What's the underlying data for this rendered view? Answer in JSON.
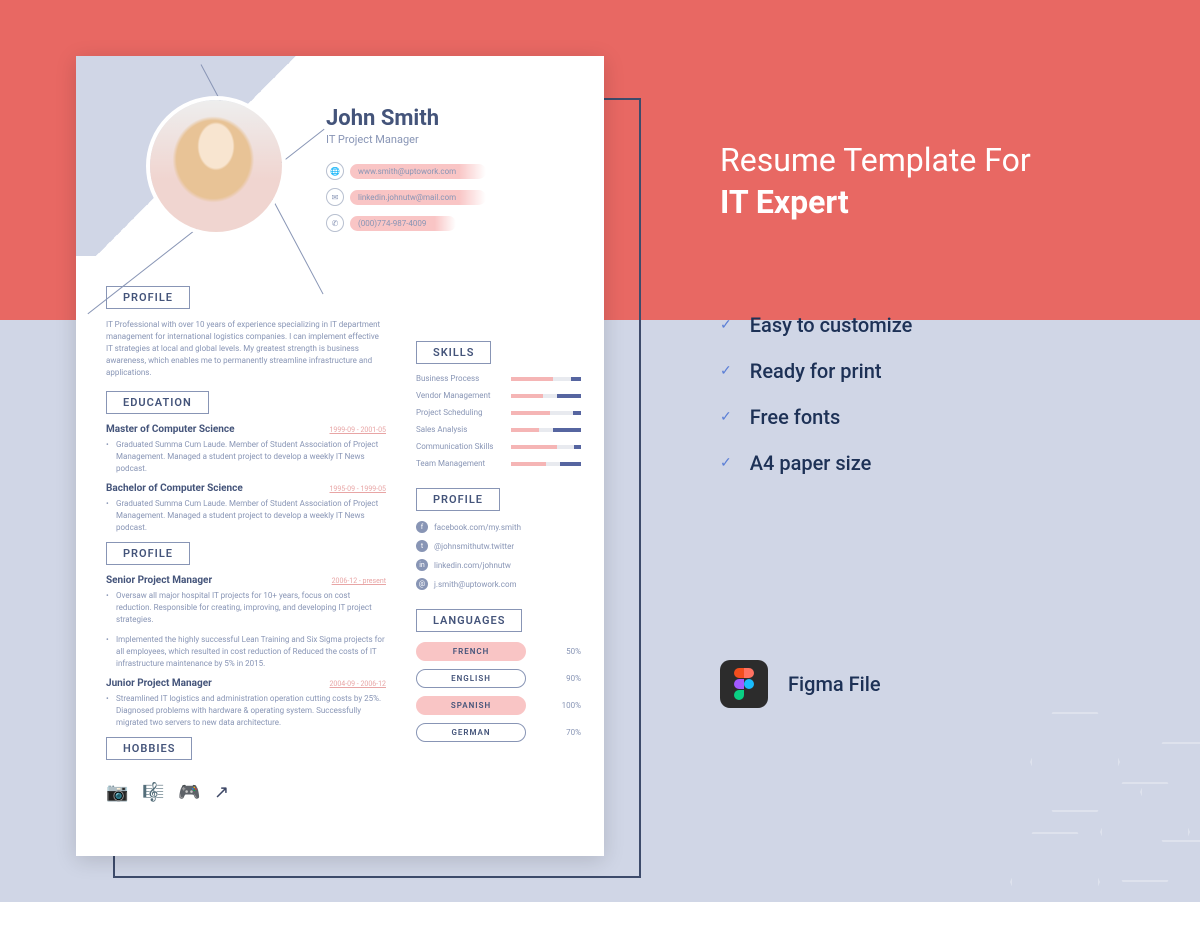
{
  "promo": {
    "title_line1": "Resume Template For",
    "title_line2": "IT Expert"
  },
  "features": [
    "Easy to customize",
    "Ready for print",
    "Free fonts",
    "A4 paper size"
  ],
  "figma_label": "Figma File",
  "resume": {
    "name": "John Smith",
    "role": "IT Project Manager",
    "contacts": [
      {
        "icon": "🌐",
        "text": "www.smith@uptowork.com"
      },
      {
        "icon": "✉",
        "text": "linkedin.johnutw@mail.com"
      },
      {
        "icon": "✆",
        "text": "(000)774-987-4009"
      }
    ],
    "sections": {
      "profile_label": "PROFILE",
      "profile_text": "IT Professional with over 10 years of experience specializing in IT department management for international logistics companies. I can implement effective IT strategies at local and global levels. My greatest strength is business awareness, which enables me to permanently streamline infrastructure and applications.",
      "education_label": "EDUCATION",
      "education": [
        {
          "title": "Master of Computer Science",
          "dates": "1999-09 - 2001-05",
          "desc": "Graduated Summa Cum Laude. Member of Student Association of Project Management. Managed a student project to develop a weekly IT News podcast."
        },
        {
          "title": "Bachelor of Computer Science",
          "dates": "1995-09 - 1999-05",
          "desc": "Graduated Summa Cum Laude. Member of Student Association of Project Management. Managed a student project to develop a weekly IT News podcast."
        }
      ],
      "experience_label": "PROFILE",
      "experience": [
        {
          "title": "Senior Project Manager",
          "dates": "2006-12 - present",
          "bullets": [
            "Oversaw all major hospital IT projects for 10+ years, focus on cost reduction. Responsible for creating, improving, and developing IT project strategies.",
            "Implemented the highly successful Lean Training and Six Sigma projects for all employees, which resulted in cost reduction of Reduced the costs of IT infrastructure maintenance by 5% in 2015."
          ]
        },
        {
          "title": "Junior Project Manager",
          "dates": "2004-09 - 2006-12",
          "bullets": [
            "Streamlined IT logistics and administration operation cutting costs by 25%. Diagnosed problems with hardware & operating system. Successfully migrated two servers to new data architecture."
          ]
        }
      ],
      "hobbies_label": "HOBBIES",
      "skills_label": "SKILLS",
      "skills": [
        {
          "name": "Business Process",
          "pink": 60,
          "blue": 15
        },
        {
          "name": "Vendor Management",
          "pink": 45,
          "blue": 35
        },
        {
          "name": "Project Scheduling",
          "pink": 55,
          "blue": 12
        },
        {
          "name": "Sales Analysis",
          "pink": 40,
          "blue": 40
        },
        {
          "name": "Communication Skills",
          "pink": 65,
          "blue": 10
        },
        {
          "name": "Team Management",
          "pink": 50,
          "blue": 30
        }
      ],
      "social_label": "PROFILE",
      "social": [
        {
          "icon": "f",
          "text": "facebook.com/my.smith"
        },
        {
          "icon": "t",
          "text": "@johnsmithutw.twitter"
        },
        {
          "icon": "in",
          "text": "linkedin.com/johnutw"
        },
        {
          "icon": "@",
          "text": "j.smith@uptowork.com"
        }
      ],
      "languages_label": "LANGUAGES",
      "languages": [
        {
          "name": "FRENCH",
          "pct": "50%",
          "pink": true
        },
        {
          "name": "ENGLISH",
          "pct": "90%",
          "pink": false
        },
        {
          "name": "SPANISH",
          "pct": "100%",
          "pink": true
        },
        {
          "name": "GERMAN",
          "pct": "70%",
          "pink": false
        }
      ]
    }
  }
}
